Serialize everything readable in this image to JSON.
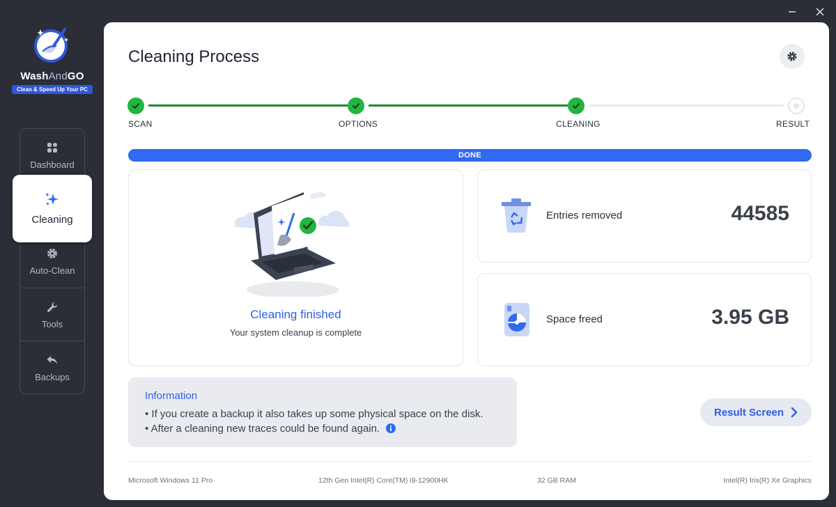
{
  "app": {
    "name_main": "Wash",
    "name_and": "And",
    "name_go": "GO",
    "tagline": "Clean & Speed Up Your PC"
  },
  "window_controls": {
    "minimize_icon": "minimize-icon",
    "close_icon": "close-icon"
  },
  "sidebar": {
    "items": [
      {
        "label": "Dashboard",
        "icon": "dashboard-icon"
      },
      {
        "label": "Cleaning",
        "icon": "sparkle-icon",
        "active": true
      },
      {
        "label": "Auto-Clean",
        "icon": "gear-icon"
      },
      {
        "label": "Tools",
        "icon": "wrench-icon"
      },
      {
        "label": "Backups",
        "icon": "undo-icon"
      }
    ]
  },
  "header": {
    "title": "Cleaning Process",
    "settings_icon": "gear-icon"
  },
  "stepper": {
    "steps": [
      {
        "label": "SCAN",
        "status": "done"
      },
      {
        "label": "OPTIONS",
        "status": "done"
      },
      {
        "label": "CLEANING",
        "status": "done"
      },
      {
        "label": "RESULT",
        "status": "pending"
      }
    ]
  },
  "progress": {
    "label": "DONE",
    "value": 1.0
  },
  "result_card": {
    "title": "Cleaning finished",
    "subtitle": "Your system cleanup is complete"
  },
  "stats": [
    {
      "label": "Entries removed",
      "value": "44585",
      "icon": "recycle-bin-icon"
    },
    {
      "label": "Space freed",
      "value": "3.95 GB",
      "icon": "disk-icon"
    }
  ],
  "info": {
    "title": "Information",
    "lines": [
      "• If you create a backup it also takes up some physical space on the disk.",
      "• After a cleaning new traces could be found again."
    ]
  },
  "result_button": {
    "label": "Result Screen"
  },
  "footer": {
    "os": "Microsoft Windows 11 Pro",
    "cpu": "12th Gen Intel(R) Core(TM) i9-12900HK",
    "ram": "32 GB RAM",
    "gpu": "Intel(R) Iris(R) Xe Graphics"
  },
  "colors": {
    "accent": "#2f6af0",
    "success": "#22b53f",
    "background": "#2b2d37"
  }
}
